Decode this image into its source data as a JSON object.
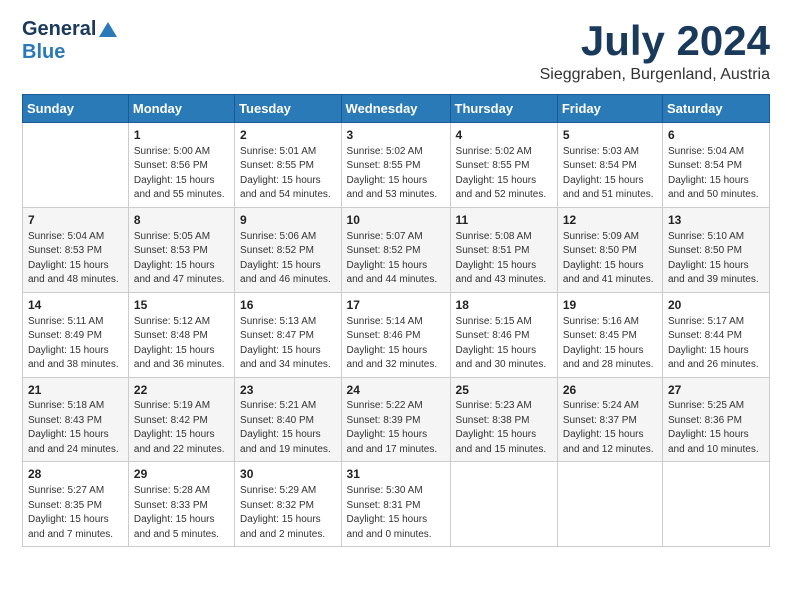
{
  "header": {
    "logo_general": "General",
    "logo_blue": "Blue",
    "month_title": "July 2024",
    "location": "Sieggraben, Burgenland, Austria"
  },
  "weekdays": [
    "Sunday",
    "Monday",
    "Tuesday",
    "Wednesday",
    "Thursday",
    "Friday",
    "Saturday"
  ],
  "weeks": [
    [
      {
        "day": "",
        "sunrise": "",
        "sunset": "",
        "daylight": ""
      },
      {
        "day": "1",
        "sunrise": "Sunrise: 5:00 AM",
        "sunset": "Sunset: 8:56 PM",
        "daylight": "Daylight: 15 hours and 55 minutes."
      },
      {
        "day": "2",
        "sunrise": "Sunrise: 5:01 AM",
        "sunset": "Sunset: 8:55 PM",
        "daylight": "Daylight: 15 hours and 54 minutes."
      },
      {
        "day": "3",
        "sunrise": "Sunrise: 5:02 AM",
        "sunset": "Sunset: 8:55 PM",
        "daylight": "Daylight: 15 hours and 53 minutes."
      },
      {
        "day": "4",
        "sunrise": "Sunrise: 5:02 AM",
        "sunset": "Sunset: 8:55 PM",
        "daylight": "Daylight: 15 hours and 52 minutes."
      },
      {
        "day": "5",
        "sunrise": "Sunrise: 5:03 AM",
        "sunset": "Sunset: 8:54 PM",
        "daylight": "Daylight: 15 hours and 51 minutes."
      },
      {
        "day": "6",
        "sunrise": "Sunrise: 5:04 AM",
        "sunset": "Sunset: 8:54 PM",
        "daylight": "Daylight: 15 hours and 50 minutes."
      }
    ],
    [
      {
        "day": "7",
        "sunrise": "Sunrise: 5:04 AM",
        "sunset": "Sunset: 8:53 PM",
        "daylight": "Daylight: 15 hours and 48 minutes."
      },
      {
        "day": "8",
        "sunrise": "Sunrise: 5:05 AM",
        "sunset": "Sunset: 8:53 PM",
        "daylight": "Daylight: 15 hours and 47 minutes."
      },
      {
        "day": "9",
        "sunrise": "Sunrise: 5:06 AM",
        "sunset": "Sunset: 8:52 PM",
        "daylight": "Daylight: 15 hours and 46 minutes."
      },
      {
        "day": "10",
        "sunrise": "Sunrise: 5:07 AM",
        "sunset": "Sunset: 8:52 PM",
        "daylight": "Daylight: 15 hours and 44 minutes."
      },
      {
        "day": "11",
        "sunrise": "Sunrise: 5:08 AM",
        "sunset": "Sunset: 8:51 PM",
        "daylight": "Daylight: 15 hours and 43 minutes."
      },
      {
        "day": "12",
        "sunrise": "Sunrise: 5:09 AM",
        "sunset": "Sunset: 8:50 PM",
        "daylight": "Daylight: 15 hours and 41 minutes."
      },
      {
        "day": "13",
        "sunrise": "Sunrise: 5:10 AM",
        "sunset": "Sunset: 8:50 PM",
        "daylight": "Daylight: 15 hours and 39 minutes."
      }
    ],
    [
      {
        "day": "14",
        "sunrise": "Sunrise: 5:11 AM",
        "sunset": "Sunset: 8:49 PM",
        "daylight": "Daylight: 15 hours and 38 minutes."
      },
      {
        "day": "15",
        "sunrise": "Sunrise: 5:12 AM",
        "sunset": "Sunset: 8:48 PM",
        "daylight": "Daylight: 15 hours and 36 minutes."
      },
      {
        "day": "16",
        "sunrise": "Sunrise: 5:13 AM",
        "sunset": "Sunset: 8:47 PM",
        "daylight": "Daylight: 15 hours and 34 minutes."
      },
      {
        "day": "17",
        "sunrise": "Sunrise: 5:14 AM",
        "sunset": "Sunset: 8:46 PM",
        "daylight": "Daylight: 15 hours and 32 minutes."
      },
      {
        "day": "18",
        "sunrise": "Sunrise: 5:15 AM",
        "sunset": "Sunset: 8:46 PM",
        "daylight": "Daylight: 15 hours and 30 minutes."
      },
      {
        "day": "19",
        "sunrise": "Sunrise: 5:16 AM",
        "sunset": "Sunset: 8:45 PM",
        "daylight": "Daylight: 15 hours and 28 minutes."
      },
      {
        "day": "20",
        "sunrise": "Sunrise: 5:17 AM",
        "sunset": "Sunset: 8:44 PM",
        "daylight": "Daylight: 15 hours and 26 minutes."
      }
    ],
    [
      {
        "day": "21",
        "sunrise": "Sunrise: 5:18 AM",
        "sunset": "Sunset: 8:43 PM",
        "daylight": "Daylight: 15 hours and 24 minutes."
      },
      {
        "day": "22",
        "sunrise": "Sunrise: 5:19 AM",
        "sunset": "Sunset: 8:42 PM",
        "daylight": "Daylight: 15 hours and 22 minutes."
      },
      {
        "day": "23",
        "sunrise": "Sunrise: 5:21 AM",
        "sunset": "Sunset: 8:40 PM",
        "daylight": "Daylight: 15 hours and 19 minutes."
      },
      {
        "day": "24",
        "sunrise": "Sunrise: 5:22 AM",
        "sunset": "Sunset: 8:39 PM",
        "daylight": "Daylight: 15 hours and 17 minutes."
      },
      {
        "day": "25",
        "sunrise": "Sunrise: 5:23 AM",
        "sunset": "Sunset: 8:38 PM",
        "daylight": "Daylight: 15 hours and 15 minutes."
      },
      {
        "day": "26",
        "sunrise": "Sunrise: 5:24 AM",
        "sunset": "Sunset: 8:37 PM",
        "daylight": "Daylight: 15 hours and 12 minutes."
      },
      {
        "day": "27",
        "sunrise": "Sunrise: 5:25 AM",
        "sunset": "Sunset: 8:36 PM",
        "daylight": "Daylight: 15 hours and 10 minutes."
      }
    ],
    [
      {
        "day": "28",
        "sunrise": "Sunrise: 5:27 AM",
        "sunset": "Sunset: 8:35 PM",
        "daylight": "Daylight: 15 hours and 7 minutes."
      },
      {
        "day": "29",
        "sunrise": "Sunrise: 5:28 AM",
        "sunset": "Sunset: 8:33 PM",
        "daylight": "Daylight: 15 hours and 5 minutes."
      },
      {
        "day": "30",
        "sunrise": "Sunrise: 5:29 AM",
        "sunset": "Sunset: 8:32 PM",
        "daylight": "Daylight: 15 hours and 2 minutes."
      },
      {
        "day": "31",
        "sunrise": "Sunrise: 5:30 AM",
        "sunset": "Sunset: 8:31 PM",
        "daylight": "Daylight: 15 hours and 0 minutes."
      },
      {
        "day": "",
        "sunrise": "",
        "sunset": "",
        "daylight": ""
      },
      {
        "day": "",
        "sunrise": "",
        "sunset": "",
        "daylight": ""
      },
      {
        "day": "",
        "sunrise": "",
        "sunset": "",
        "daylight": ""
      }
    ]
  ]
}
